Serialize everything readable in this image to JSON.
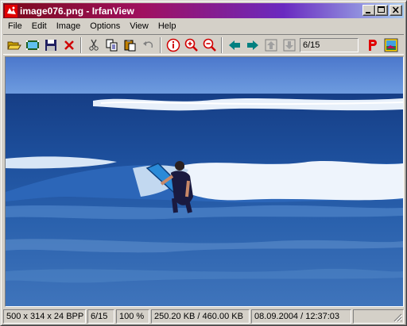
{
  "window": {
    "title": "image076.png - IrfanView"
  },
  "menu": [
    "File",
    "Edit",
    "Image",
    "Options",
    "View",
    "Help"
  ],
  "toolbar": {
    "buttons": [
      "open-folder-icon",
      "slideshow-icon",
      "save-icon",
      "delete-icon",
      "cut-icon",
      "copy-icon",
      "paste-icon",
      "undo-icon",
      "info-icon",
      "zoom-in-icon",
      "zoom-out-icon",
      "previous-icon",
      "next-icon",
      "first-page-icon",
      "last-page-icon",
      "paint-icon",
      "thumbnails-icon"
    ],
    "page_indicator": "6/15"
  },
  "status": {
    "dimensions": "500 x 314 x 24 BPP",
    "page": "6/15",
    "zoom": "100 %",
    "size": "250.20 KB / 460.00 KB",
    "datetime": "08.09.2004 / 12:37:03"
  },
  "colors": {
    "title_gradient_start": "#7a0a1a",
    "title_gradient_end": "#a6caf0",
    "chrome": "#d4d0c8",
    "ocean": "#1f4f9a",
    "sky": "#4a74c8"
  }
}
